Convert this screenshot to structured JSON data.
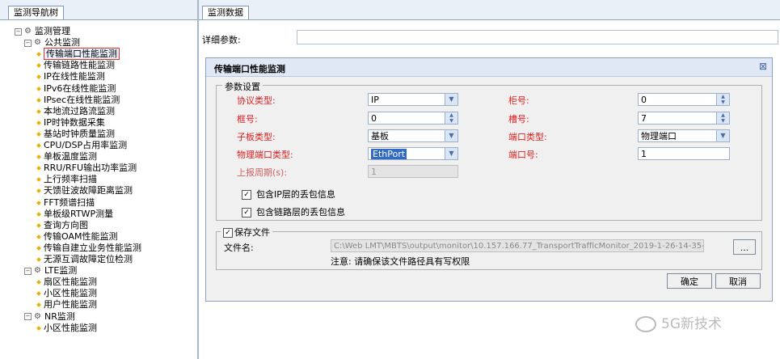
{
  "left_panel": {
    "tab_label": "监测导航树",
    "tree": [
      {
        "label": "监测管理",
        "level": 0,
        "kind": "group"
      },
      {
        "label": "公共监测",
        "level": 1,
        "kind": "group"
      },
      {
        "label": "传输端口性能监测",
        "level": 2,
        "kind": "leaf",
        "selected": true
      },
      {
        "label": "传输链路性能监测",
        "level": 2,
        "kind": "leaf"
      },
      {
        "label": "IP在线性能监测",
        "level": 2,
        "kind": "leaf"
      },
      {
        "label": "IPv6在线性能监测",
        "level": 2,
        "kind": "leaf"
      },
      {
        "label": "IPsec在线性能监测",
        "level": 2,
        "kind": "leaf"
      },
      {
        "label": "本地流过路流监测",
        "level": 2,
        "kind": "leaf"
      },
      {
        "label": "IP时钟数据采集",
        "level": 2,
        "kind": "leaf"
      },
      {
        "label": "基站时钟质量监测",
        "level": 2,
        "kind": "leaf"
      },
      {
        "label": "CPU/DSP占用率监测",
        "level": 2,
        "kind": "leaf"
      },
      {
        "label": "单板温度监测",
        "level": 2,
        "kind": "leaf"
      },
      {
        "label": "RRU/RFU输出功率监测",
        "level": 2,
        "kind": "leaf"
      },
      {
        "label": "上行频率扫描",
        "level": 2,
        "kind": "leaf"
      },
      {
        "label": "天馈驻波故障距离监测",
        "level": 2,
        "kind": "leaf"
      },
      {
        "label": "FFT频谱扫描",
        "level": 2,
        "kind": "leaf"
      },
      {
        "label": "单板级RTWP测量",
        "level": 2,
        "kind": "leaf"
      },
      {
        "label": "查询方向图",
        "level": 2,
        "kind": "leaf"
      },
      {
        "label": "传输OAM性能监测",
        "level": 2,
        "kind": "leaf"
      },
      {
        "label": "传输自建立业务性能监测",
        "level": 2,
        "kind": "leaf"
      },
      {
        "label": "无源互调故障定位检测",
        "level": 2,
        "kind": "leaf"
      },
      {
        "label": "LTE监测",
        "level": 1,
        "kind": "group"
      },
      {
        "label": "扇区性能监测",
        "level": 2,
        "kind": "leaf"
      },
      {
        "label": "小区性能监测",
        "level": 2,
        "kind": "leaf"
      },
      {
        "label": "用户性能监测",
        "level": 2,
        "kind": "leaf"
      },
      {
        "label": "NR监测",
        "level": 1,
        "kind": "group"
      },
      {
        "label": "小区性能监测",
        "level": 2,
        "kind": "leaf"
      }
    ]
  },
  "right_panel": {
    "tab_label": "监测数据",
    "detail_label": "详细参数:",
    "dialog": {
      "title": "传输端口性能监测",
      "params_group": "参数设置",
      "protocol_type": {
        "label": "协议类型:",
        "value": "IP"
      },
      "frame_no": {
        "label": "框号:",
        "value": "0"
      },
      "subboard_type": {
        "label": "子板类型:",
        "value": "基板"
      },
      "phys_port_type": {
        "label": "物理端口类型:",
        "value": "EthPort"
      },
      "report_period": {
        "label": "上报周期(s):",
        "value": "1"
      },
      "cabinet_no": {
        "label": "柜号:",
        "value": "0"
      },
      "slot_no": {
        "label": "槽号:",
        "value": "7"
      },
      "port_type": {
        "label": "端口类型:",
        "value": "物理端口"
      },
      "port_no": {
        "label": "端口号:",
        "value": "1"
      },
      "chk_ip": {
        "label": "包含IP层的丢包信息",
        "checked": true
      },
      "chk_link": {
        "label": "包含链路层的丢包信息",
        "checked": true
      },
      "save_group": {
        "label": "保存文件",
        "checked": true
      },
      "file_name_label": "文件名:",
      "file_path": "C:\\Web LMT\\MBTS\\output\\monitor\\10.157.166.77_TransportTrafficMonitor_2019-1-26-14-35-",
      "browse_label": "...",
      "note": "注意: 请确保该文件路径具有写权限",
      "ok_label": "确定",
      "cancel_label": "取消",
      "close_glyph": "⊠"
    },
    "watermark": "5G新技术"
  },
  "colors": {
    "required_label": "#e02020",
    "disabled_label": "#d06060",
    "border": "#9bb0cc"
  }
}
